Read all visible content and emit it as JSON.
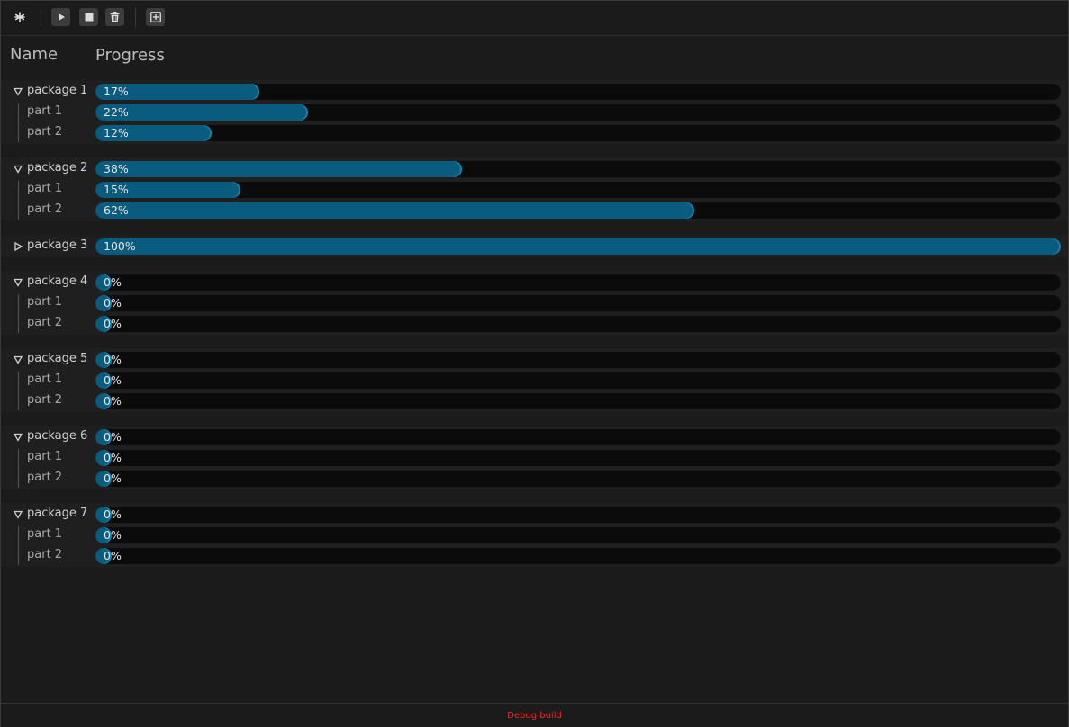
{
  "toolbar": {
    "buttons": [
      {
        "icon": "asterisk-icon"
      },
      {
        "icon": "play-icon"
      },
      {
        "icon": "stop-icon"
      },
      {
        "icon": "trash-icon"
      },
      {
        "icon": "add-box-icon"
      }
    ]
  },
  "header": {
    "name": "Name",
    "progress": "Progress"
  },
  "packages": [
    {
      "name": "package 1",
      "expanded": true,
      "progress": 17,
      "progress_label": "17%",
      "parts": [
        {
          "name": "part 1",
          "progress": 22,
          "progress_label": "22%"
        },
        {
          "name": "part 2",
          "progress": 12,
          "progress_label": "12%"
        }
      ]
    },
    {
      "name": "package 2",
      "expanded": true,
      "progress": 38,
      "progress_label": "38%",
      "parts": [
        {
          "name": "part 1",
          "progress": 15,
          "progress_label": "15%"
        },
        {
          "name": "part 2",
          "progress": 62,
          "progress_label": "62%"
        }
      ]
    },
    {
      "name": "package 3",
      "expanded": false,
      "progress": 100,
      "progress_label": "100%",
      "parts": []
    },
    {
      "name": "package 4",
      "expanded": true,
      "progress": 0,
      "progress_label": "0%",
      "parts": [
        {
          "name": "part 1",
          "progress": 0,
          "progress_label": "0%"
        },
        {
          "name": "part 2",
          "progress": 0,
          "progress_label": "0%"
        }
      ]
    },
    {
      "name": "package 5",
      "expanded": true,
      "progress": 0,
      "progress_label": "0%",
      "parts": [
        {
          "name": "part 1",
          "progress": 0,
          "progress_label": "0%"
        },
        {
          "name": "part 2",
          "progress": 0,
          "progress_label": "0%"
        }
      ]
    },
    {
      "name": "package 6",
      "expanded": true,
      "progress": 0,
      "progress_label": "0%",
      "parts": [
        {
          "name": "part 1",
          "progress": 0,
          "progress_label": "0%"
        },
        {
          "name": "part 2",
          "progress": 0,
          "progress_label": "0%"
        }
      ]
    },
    {
      "name": "package 7",
      "expanded": true,
      "progress": 0,
      "progress_label": "0%",
      "parts": [
        {
          "name": "part 1",
          "progress": 0,
          "progress_label": "0%"
        },
        {
          "name": "part 2",
          "progress": 0,
          "progress_label": "0%"
        }
      ]
    }
  ],
  "status": {
    "text": "Debug build"
  },
  "colors": {
    "background": "#1b1b1b",
    "bar_track": "#0b0b0b",
    "bar_fill": "#0a5c7e",
    "status_text": "#e03030"
  }
}
